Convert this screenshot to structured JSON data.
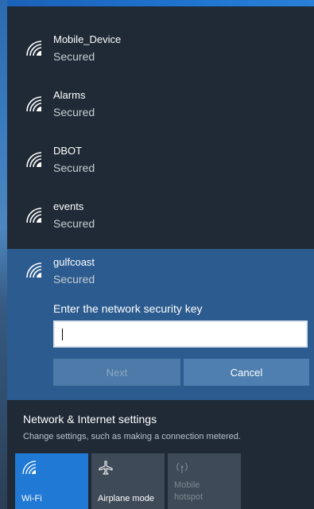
{
  "networks": [
    {
      "name": "Mobile_Device",
      "status": "Secured"
    },
    {
      "name": "Alarms",
      "status": "Secured"
    },
    {
      "name": "DBOT",
      "status": "Secured"
    },
    {
      "name": "events",
      "status": "Secured"
    }
  ],
  "selected_network": {
    "name": "gulfcoast",
    "status": "Secured",
    "key_prompt": "Enter the network security key",
    "key_value": "",
    "next_label": "Next",
    "cancel_label": "Cancel"
  },
  "settings": {
    "title": "Network & Internet settings",
    "description": "Change settings, such as making a connection metered."
  },
  "quick_actions": {
    "wifi": {
      "label": "Wi-Fi",
      "icon": "wifi-icon",
      "active": true
    },
    "airplane": {
      "label": "Airplane mode",
      "icon": "airplane-icon",
      "active": false
    },
    "hotspot": {
      "label": "Mobile hotspot",
      "icon": "hotspot-icon",
      "active": false
    }
  },
  "colors": {
    "accent": "#2179d6",
    "panel_bg": "#1f2a36",
    "selected_bg": "#2b5b8f"
  }
}
